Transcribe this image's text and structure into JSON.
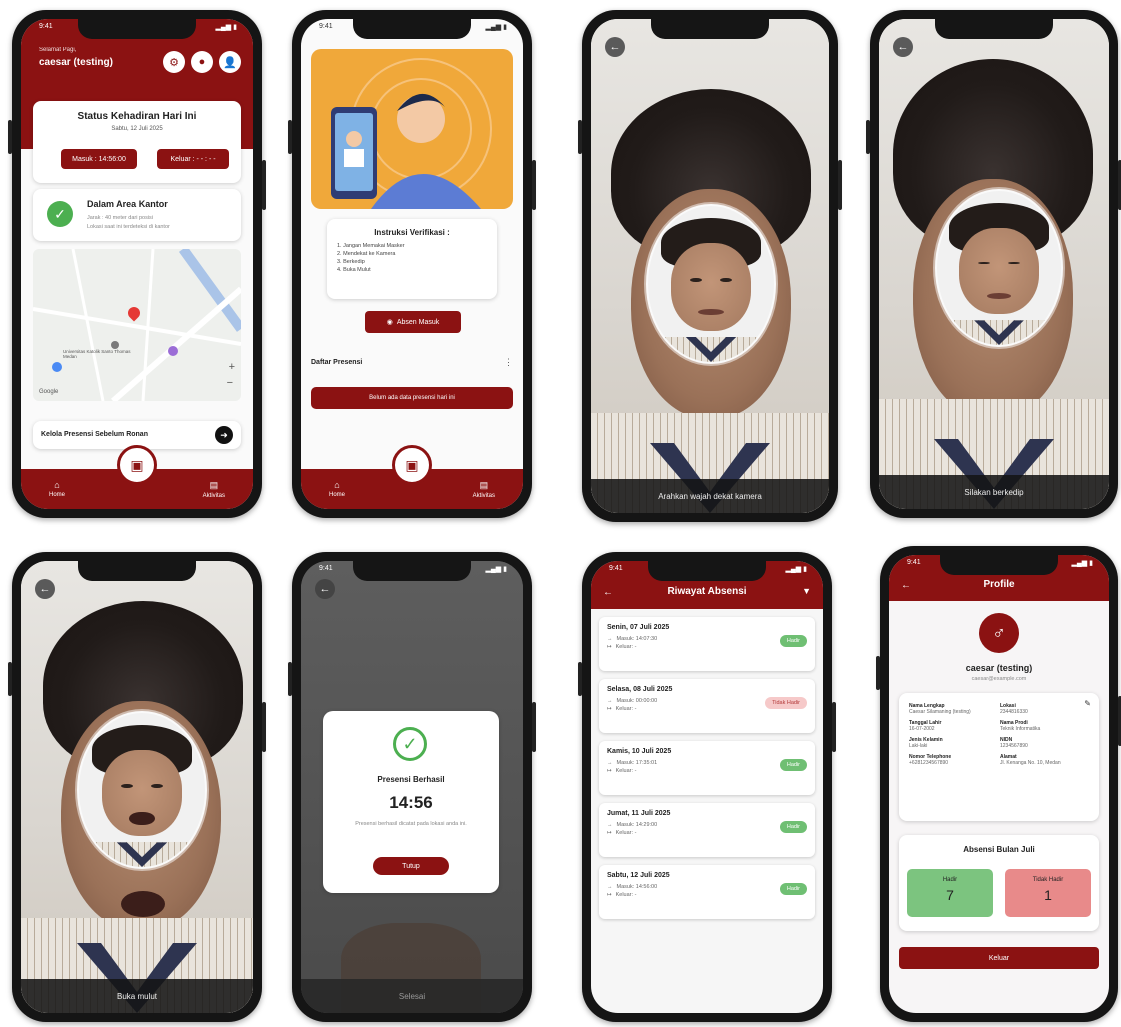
{
  "colors": {
    "primary": "#8b1212",
    "success": "#6fbf73",
    "danger": "#e88a8a"
  },
  "home": {
    "greeting": "Selamat Pagi,",
    "user": "caesar (testing)",
    "status_title": "Status Kehadiran Hari Ini",
    "date": "Sabtu, 12 Juli 2025",
    "masuk_btn": "Masuk : 14:56:00",
    "keluar_btn": "Keluar : - - : - -",
    "area_title": "Dalam Area Kantor",
    "area_sub1": "Jarak : 40 meter dari posisi",
    "area_sub2": "Lokasi saat ini terdeteksi di kantor",
    "map_labels": [
      "Universitas Katolik Santo Thomas Medan",
      "Google"
    ],
    "back_prompt": "Kelola Presensi Sebelum Ronan",
    "nav_home": "Home",
    "nav_activity": "Aktivitas"
  },
  "verify": {
    "instr_title": "Instruksi Verifikasi :",
    "instr_items": [
      "1. Jangan Memakai Masker",
      "2. Mendekat ke Kamera",
      "3. Berkedip",
      "4. Buka Mulut"
    ],
    "absen_btn": "Absen Masuk",
    "list_title": "Daftar Presensi",
    "empty_btn": "Belum ada data presensi hari ini",
    "nav_home": "Home",
    "nav_activity": "Aktivitas"
  },
  "camera": {
    "caption1": "Arahkan wajah dekat kamera",
    "caption2": "Silakan berkedip",
    "caption3": "Buka mulut",
    "caption4": "Selesai"
  },
  "success_dialog": {
    "title": "Presensi Berhasil",
    "time": "14:56",
    "message": "Presensi berhasil dicatat pada lokasi anda ini.",
    "button": "Tutup"
  },
  "history": {
    "title": "Riwayat Absensi",
    "items": [
      {
        "date": "Senin, 07 Juli 2025",
        "masuk": "Masuk: 14:07:30",
        "keluar": "Keluar: -",
        "status": "Hadir",
        "ok": true
      },
      {
        "date": "Selasa, 08 Juli 2025",
        "masuk": "Masuk: 00:00:00",
        "keluar": "Keluar: -",
        "status": "Tidak Hadir",
        "ok": false
      },
      {
        "date": "Kamis, 10 Juli 2025",
        "masuk": "Masuk: 17:35:01",
        "keluar": "Keluar: -",
        "status": "Hadir",
        "ok": true
      },
      {
        "date": "Jumat, 11 Juli 2025",
        "masuk": "Masuk: 14:29:00",
        "keluar": "Keluar: -",
        "status": "Hadir",
        "ok": true
      },
      {
        "date": "Sabtu, 12 Juli 2025",
        "masuk": "Masuk: 14:56:00",
        "keluar": "Keluar: -",
        "status": "Hadir",
        "ok": true
      }
    ]
  },
  "profile": {
    "title": "Profile",
    "name": "caesar (testing)",
    "email": "caesar@example.com",
    "fields": [
      {
        "label": "Nama Lengkap",
        "value": "Caesar Silamaning (testing)"
      },
      {
        "label": "Lokasi",
        "value": "2344816330"
      },
      {
        "label": "Tanggal Lahir",
        "value": "16-07-2002"
      },
      {
        "label": "Nama Prodi",
        "value": "Teknik Informatika"
      },
      {
        "label": "Jenis Kelamin",
        "value": "Laki-laki"
      },
      {
        "label": "NIDN",
        "value": "1234567890"
      },
      {
        "label": "Nomor Telephone",
        "value": "+6281234567890"
      },
      {
        "label": "Alamat",
        "value": "Jl. Kenanga No. 10, Medan"
      }
    ],
    "summary_title": "Absensi Bulan Juli",
    "hadir_label": "Hadir",
    "hadir_value": "7",
    "tidak_label": "Tidak Hadir",
    "tidak_value": "1",
    "logout": "Keluar"
  }
}
